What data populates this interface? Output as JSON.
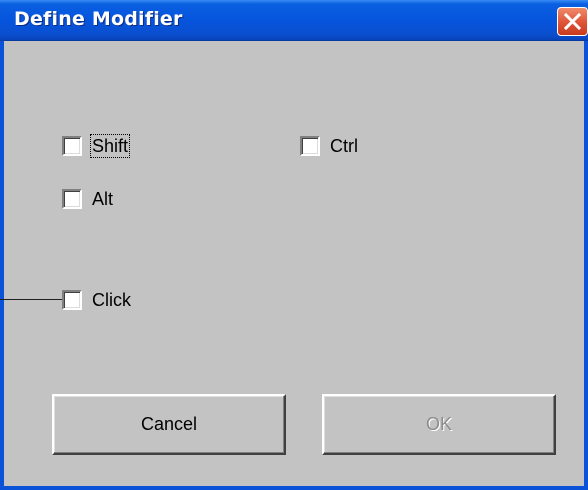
{
  "window": {
    "title": "Define Modifier"
  },
  "modifiers": {
    "shift": {
      "label": "Shift",
      "checked": false
    },
    "ctrl": {
      "label": "Ctrl",
      "checked": false
    },
    "alt": {
      "label": "Alt",
      "checked": false
    },
    "click": {
      "label": "Click",
      "checked": false
    }
  },
  "buttons": {
    "cancel_label": "Cancel",
    "ok_label": "OK",
    "ok_disabled": true
  },
  "colors": {
    "titlebar": "#0655de",
    "dialog_bg": "#c3c3c3",
    "close_button": "#e0573a"
  },
  "icons": {
    "close": "close-icon"
  }
}
